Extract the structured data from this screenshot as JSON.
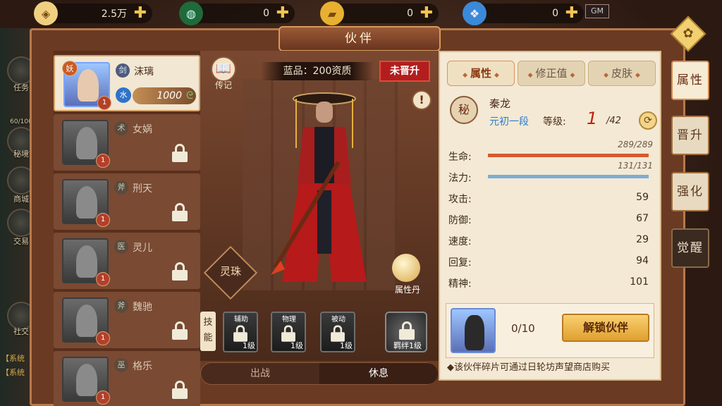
{
  "resources": [
    {
      "icon": "coin-icon",
      "value": "2.5万"
    },
    {
      "icon": "jade-icon",
      "value": "0"
    },
    {
      "icon": "gold-ingot-icon",
      "value": "0"
    },
    {
      "icon": "crystal-icon",
      "value": "0"
    }
  ],
  "gm_label": "GM",
  "window_title": "伙伴",
  "side": {
    "labels": [
      "任务",
      "秘境",
      "商城",
      "交易",
      "社交"
    ],
    "level_text": "60/100",
    "sys_lines": [
      "【系统",
      "【系统"
    ]
  },
  "partners": [
    {
      "name": "沫璃",
      "type": "剑",
      "rank": "妖",
      "stars": "1",
      "power": "1000",
      "elem": "水",
      "active": true,
      "locked": false
    },
    {
      "name": "女娲",
      "type": "术",
      "stars": "1",
      "locked": true
    },
    {
      "name": "刑天",
      "type": "斧",
      "stars": "1",
      "locked": true
    },
    {
      "name": "灵儿",
      "type": "医",
      "stars": "1",
      "locked": true
    },
    {
      "name": "魏驰",
      "type": "斧",
      "stars": "1",
      "locked": true
    },
    {
      "name": "格乐",
      "type": "巫",
      "stars": "1",
      "locked": true
    }
  ],
  "stage": {
    "quality": "蓝品：200资质",
    "unadvanced": "未晋升",
    "legend_label": "传记",
    "legend_glyph": "📖",
    "info_glyph": "!",
    "spirit_label": "灵珠",
    "orb_label": "属性丹"
  },
  "skills": {
    "tab_label": "技能",
    "items": [
      {
        "name": "辅助",
        "level": "1级"
      },
      {
        "name": "物理",
        "level": "1级"
      },
      {
        "name": "被动",
        "level": "1级"
      }
    ],
    "bond": {
      "level": "羁绊1级"
    }
  },
  "toggle": {
    "out": "出战",
    "rest": "休息"
  },
  "panel": {
    "tabs": [
      "属性",
      "修正值",
      "皮肤"
    ],
    "emblem": "秘",
    "hero_name": "秦龙",
    "hero_rank": "元初一段",
    "level_label": "等级:",
    "level": "1",
    "level_max": "/42",
    "hp": {
      "label": "生命:",
      "value": "289/289",
      "fraction": 1.0,
      "color": "#d65a2e"
    },
    "mp": {
      "label": "法力:",
      "value": "131/131",
      "fraction": 1.0,
      "color": "#7aaed6"
    },
    "stats": [
      {
        "label": "攻击:",
        "value": "59"
      },
      {
        "label": "防御:",
        "value": "67"
      },
      {
        "label": "速度:",
        "value": "29"
      },
      {
        "label": "回复:",
        "value": "94"
      },
      {
        "label": "精神:",
        "value": "101"
      }
    ],
    "shards": "0/10",
    "unlock_label": "解锁伙伴",
    "hint": "◆该伙伴碎片可通过日轮坊声望商店购买"
  },
  "vtabs": [
    {
      "label": "属性",
      "state": "active"
    },
    {
      "label": "晋升",
      "state": "normal"
    },
    {
      "label": "强化",
      "state": "normal"
    },
    {
      "label": "觉醒",
      "state": "dark"
    }
  ],
  "colors": {
    "accent": "#c02010",
    "panel_bg": "#f4e9d4",
    "frame": "#b77a4c"
  }
}
